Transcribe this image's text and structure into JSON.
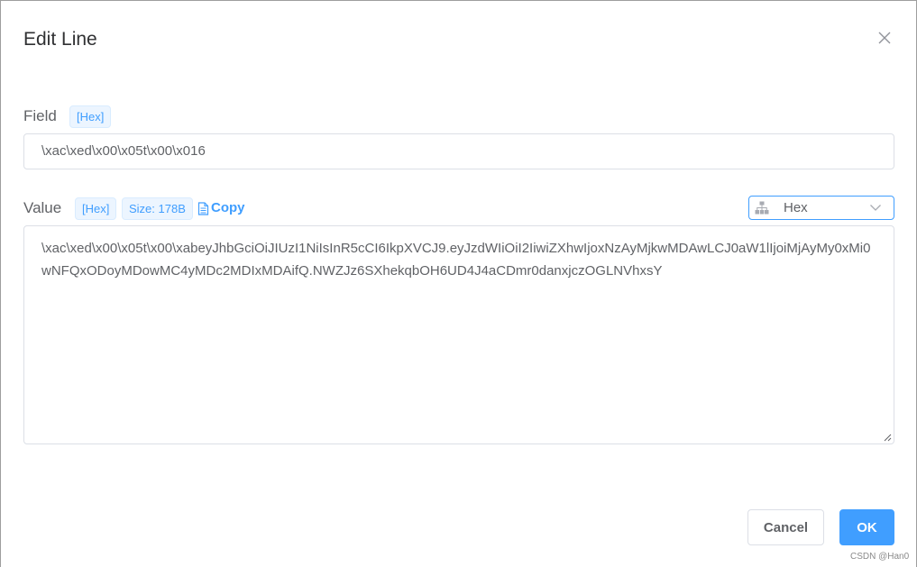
{
  "dialog": {
    "title": "Edit Line",
    "close_icon": "close-icon"
  },
  "field": {
    "label": "Field",
    "format_tag": "[Hex]",
    "value": "\\xac\\xed\\x00\\x05t\\x00\\x016"
  },
  "value_section": {
    "label": "Value",
    "format_tag": "[Hex]",
    "size_tag": "Size: 178B",
    "copy_label": "Copy",
    "copy_icon": "document-icon",
    "view_select": {
      "icon": "tree-icon",
      "selected": "Hex"
    },
    "content": "\\xac\\xed\\x00\\x05t\\x00\\xabeyJhbGciOiJIUzI1NiIsInR5cCI6IkpXVCJ9.eyJzdWIiOiI2IiwiZXhwIjoxNzAyMjkwMDAwLCJ0aW1lIjoiMjAyMy0xMi0wNFQxODoyMDowMC4yMDc2MDIxMDAifQ.NWZJz6SXhekqbOH6UD4J4aCDmr0danxjczOGLNVhxsY"
  },
  "footer": {
    "cancel_label": "Cancel",
    "ok_label": "OK"
  },
  "watermark": "CSDN @Han0",
  "colors": {
    "accent": "#409eff",
    "border": "#dcdfe6",
    "text": "#606266",
    "title": "#303133"
  }
}
